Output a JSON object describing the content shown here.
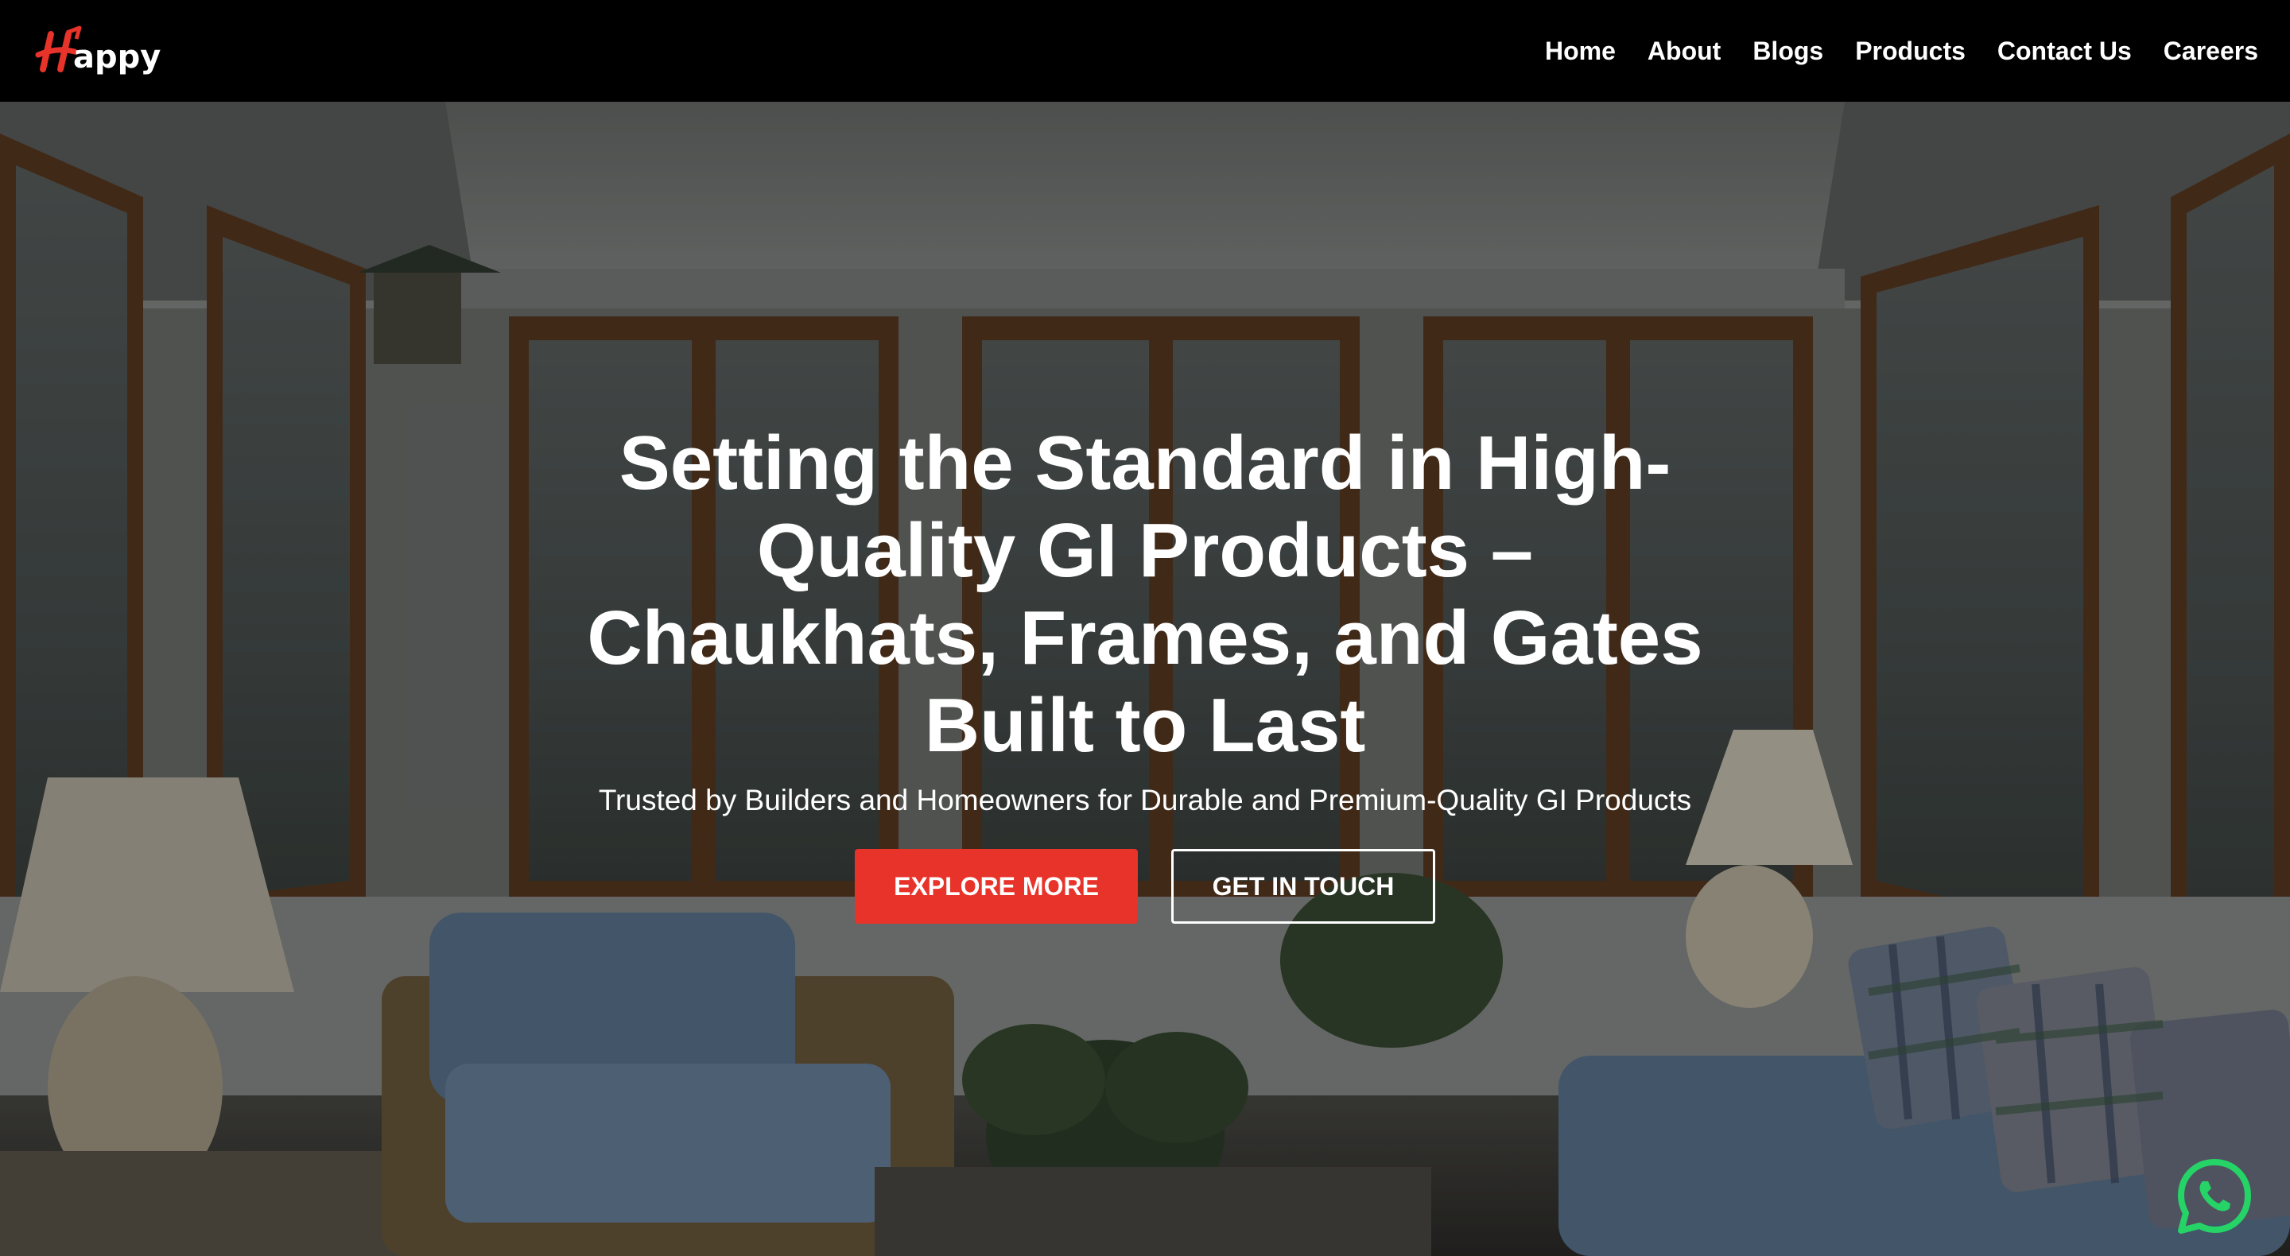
{
  "brand": {
    "logo_text": "appy",
    "logo_mark": "H",
    "accent_color": "#e8332a"
  },
  "nav": {
    "items": [
      {
        "label": "Home"
      },
      {
        "label": "About"
      },
      {
        "label": "Blogs"
      },
      {
        "label": "Products"
      },
      {
        "label": "Contact Us"
      },
      {
        "label": "Careers"
      }
    ]
  },
  "hero": {
    "title": "Setting the Standard in High-Quality GI Products – Chaukhats, Frames, and Gates Built to Last",
    "subtitle": "Trusted by Builders and Homeowners for Durable and Premium-Quality GI Products",
    "primary_button": "EXPLORE MORE",
    "secondary_button": "GET IN TOUCH",
    "background_icon": "sunroom-photo"
  },
  "floating": {
    "whatsapp_icon": "whatsapp-icon",
    "whatsapp_color": "#25d366"
  }
}
